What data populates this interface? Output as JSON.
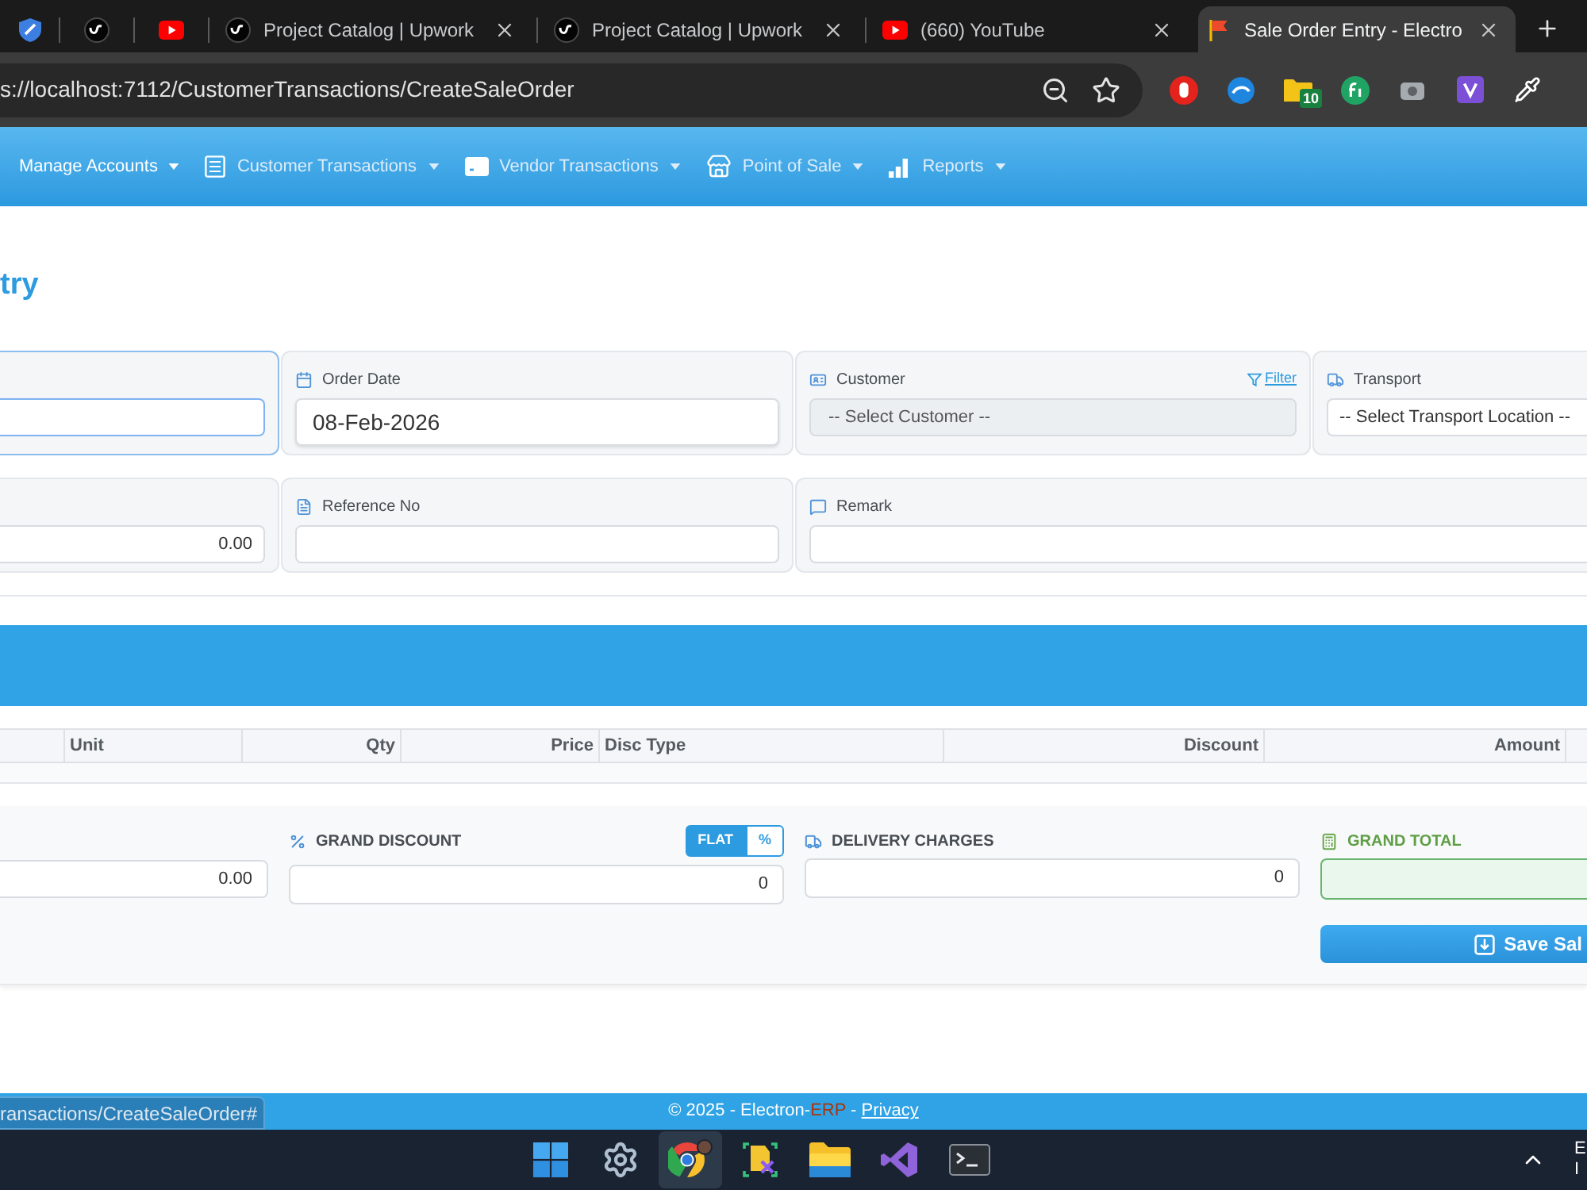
{
  "browser": {
    "tabs": [
      {
        "kind": "pinned",
        "selected": false
      },
      {
        "kind": "pinned",
        "selected": false
      },
      {
        "kind": "pinned",
        "selected": false
      },
      {
        "kind": "page",
        "title": "Project Catalog | Upwork",
        "selected": false
      },
      {
        "kind": "page",
        "title": "Project Catalog | Upwork",
        "selected": false
      },
      {
        "kind": "page",
        "title": "(660) YouTube",
        "selected": false
      },
      {
        "kind": "page",
        "title": "Sale Order Entry - Electro",
        "selected": true
      }
    ],
    "address": "s://localhost:7112/CustomerTransactions/CreateSaleOrder",
    "extension_badge": "10"
  },
  "nav": {
    "items": [
      {
        "label": "Manage Accounts",
        "selected": true
      },
      {
        "label": "Customer Transactions",
        "selected": false
      },
      {
        "label": "Vendor Transactions",
        "selected": false
      },
      {
        "label": "Point of Sale",
        "selected": false
      },
      {
        "label": "Reports",
        "selected": false
      }
    ]
  },
  "page_title": "try",
  "order_form": {
    "rows": [
      [
        {
          "kind": "text",
          "focused": true
        },
        {
          "kind": "date",
          "label": "Order Date",
          "value": "08-Feb-2026",
          "focused": false
        },
        {
          "kind": "lookup",
          "label": "Customer",
          "value": "-- Select Customer --",
          "link": "Filter",
          "focused": false
        },
        {
          "kind": "select",
          "label": "Transport",
          "value": "-- Select Transport Location --",
          "focused": false
        }
      ],
      [
        {
          "kind": "amount",
          "value": "0.00",
          "focused": false
        },
        {
          "kind": "text",
          "label": "Reference No",
          "focused": false
        },
        {
          "kind": "text",
          "label": "Remark",
          "focused": false
        }
      ]
    ]
  },
  "items_table": {
    "columns": [
      {
        "label": "Unit",
        "kind": "text"
      },
      {
        "label": "Qty",
        "kind": "number"
      },
      {
        "label": "Price",
        "kind": "number"
      },
      {
        "label": "Disc Type",
        "kind": "text"
      },
      {
        "label": "Discount",
        "kind": "number"
      },
      {
        "label": "Amount",
        "kind": "number"
      }
    ]
  },
  "totals": {
    "fields": [
      {
        "kind": "amount",
        "value": "0.00"
      },
      {
        "kind": "discount",
        "label": "GRAND DISCOUNT",
        "value": "0",
        "modes": [
          {
            "label": "FLAT",
            "selected": true
          },
          {
            "label": "%",
            "selected": false
          }
        ]
      },
      {
        "kind": "charges",
        "label": "DELIVERY CHARGES",
        "value": "0"
      },
      {
        "kind": "total",
        "label": "GRAND TOTAL"
      }
    ],
    "save_button": "Save Sal"
  },
  "footer": {
    "before": "© 2025 - Electron-",
    "accent": "ERP",
    "after": " - ",
    "link": "Privacy"
  },
  "status_bubble": "ransactions/CreateSaleOrder#",
  "taskbar": {
    "apps": [
      {
        "selected": false
      },
      {
        "selected": false
      },
      {
        "selected": true
      },
      {
        "selected": false
      },
      {
        "selected": false
      },
      {
        "selected": false
      },
      {
        "selected": false
      }
    ],
    "tray_text": [
      "E",
      "I"
    ]
  }
}
